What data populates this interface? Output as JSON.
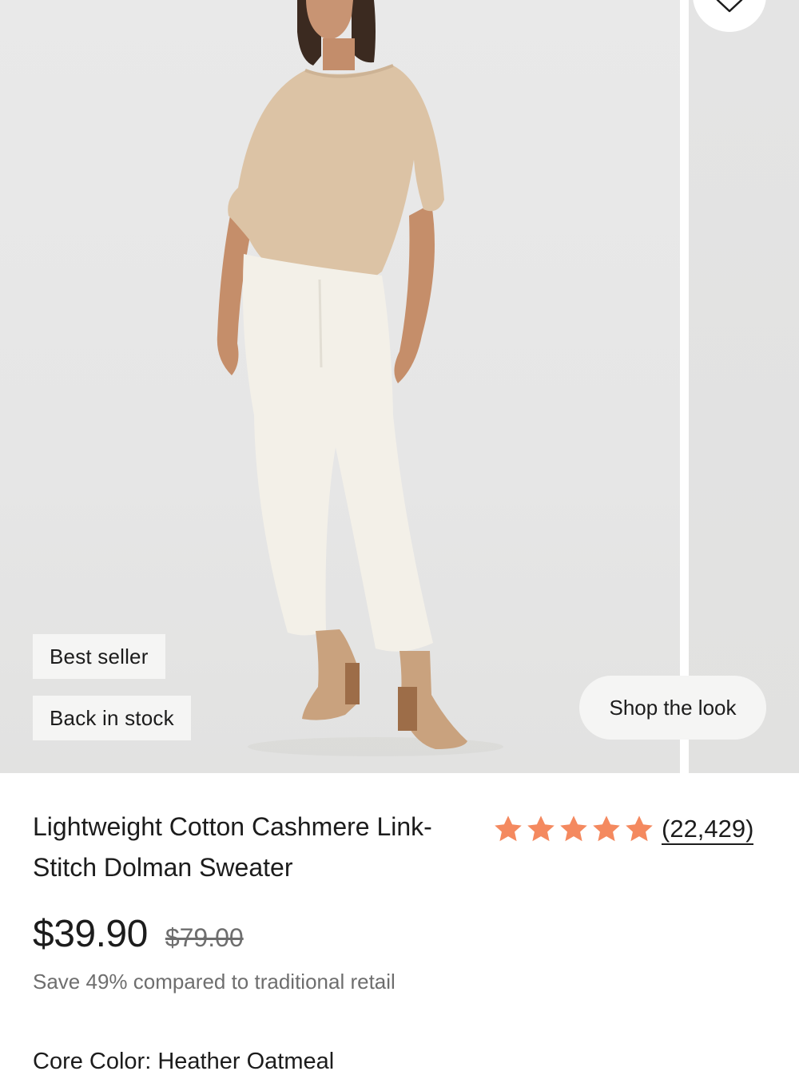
{
  "badges": {
    "best_seller": "Best seller",
    "back_in_stock": "Back in stock"
  },
  "shop_the_look": "Shop the look",
  "product": {
    "title": "Lightweight Cotton Cashmere Link-Stitch Dolman Sweater",
    "rating_stars": 5,
    "review_count": "(22,429)",
    "price": "$39.90",
    "compare_price": "$79.00",
    "savings": "Save 49% compared to traditional retail",
    "color_label": "Core Color:",
    "color_value": "Heather Oatmeal"
  },
  "colors": {
    "star": "#f4895f",
    "text": "#1c1c1c",
    "muted": "#6e6e6e",
    "badge_bg": "#f5f5f4"
  },
  "icons": {
    "wishlist": "heart-icon",
    "star": "star-icon"
  }
}
